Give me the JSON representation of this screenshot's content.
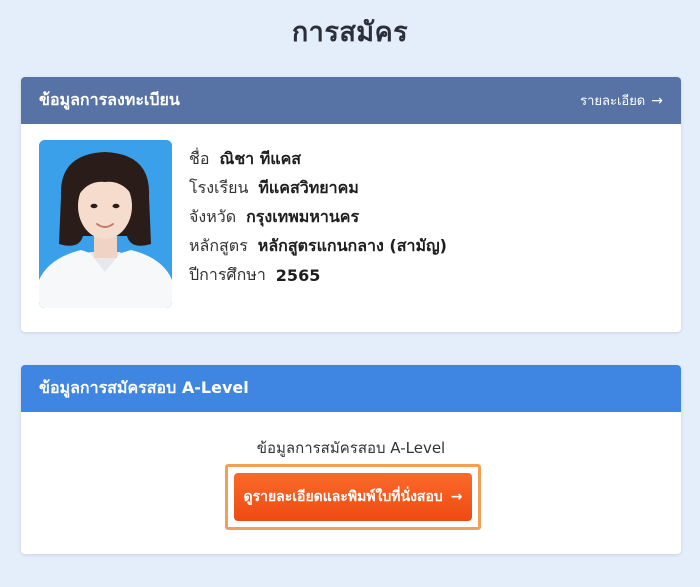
{
  "page": {
    "title": "การสมัคร"
  },
  "registration_card": {
    "title": "ข้อมูลการลงทะเบียน",
    "detail_link": "รายละเอียด",
    "arrow": "→",
    "fields": [
      {
        "label": "ชื่อ",
        "value": "ณิชา ทีแคส"
      },
      {
        "label": "โรงเรียน",
        "value": "ทีแคสวิทยาคม"
      },
      {
        "label": "จังหวัด",
        "value": "กรุงเทพมหานคร"
      },
      {
        "label": "หลักสูตร",
        "value": "หลักสูตรแกนกลาง (สามัญ)"
      },
      {
        "label": "ปีการศึกษา",
        "value": "2565"
      }
    ]
  },
  "alevel_card": {
    "title": "ข้อมูลการสมัครสอบ A-Level",
    "body_text": "ข้อมูลการสมัครสอบ A-Level",
    "button_label": "ดูรายละเอียดและพิมพ์ใบที่นั่งสอบ",
    "arrow": "→"
  },
  "colors": {
    "background": "#e4eefa",
    "registration_header": "#5772a5",
    "alevel_header": "#3f86e2",
    "button": "#ee4a12",
    "button_highlight": "#f2a056"
  },
  "icons": [
    "profile-photo",
    "arrow-right-icon"
  ]
}
